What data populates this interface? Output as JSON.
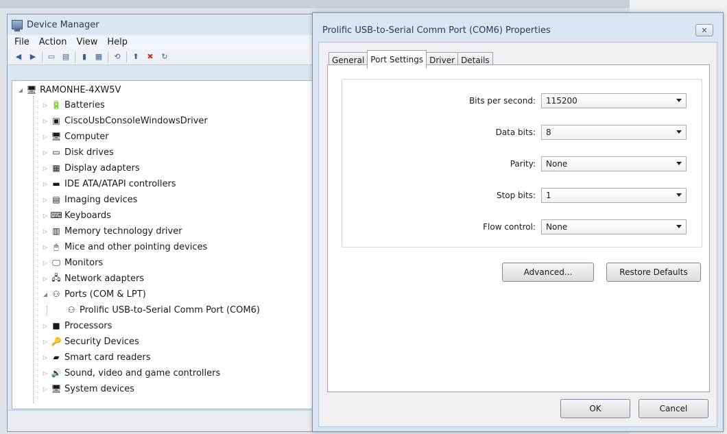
{
  "device_manager": {
    "title": "Device Manager",
    "menu": [
      "File",
      "Action",
      "View",
      "Help"
    ],
    "root": "RAMONHE-4XW5V",
    "tree": [
      {
        "label": "Batteries",
        "icon": "battery-icon",
        "glyph": "🔋",
        "expanded": false
      },
      {
        "label": "CiscoUsbConsoleWindowsDriver",
        "icon": "usb-driver-icon",
        "glyph": "▣",
        "expanded": false
      },
      {
        "label": "Computer",
        "icon": "computer-icon",
        "glyph": "🖥",
        "expanded": false
      },
      {
        "label": "Disk drives",
        "icon": "disk-drive-icon",
        "glyph": "▭",
        "expanded": false
      },
      {
        "label": "Display adapters",
        "icon": "display-adapter-icon",
        "glyph": "▦",
        "expanded": false
      },
      {
        "label": "IDE ATA/ATAPI controllers",
        "icon": "ide-controller-icon",
        "glyph": "▬",
        "expanded": false
      },
      {
        "label": "Imaging devices",
        "icon": "imaging-device-icon",
        "glyph": "▤",
        "expanded": false
      },
      {
        "label": "Keyboards",
        "icon": "keyboard-icon",
        "glyph": "⌨",
        "expanded": false
      },
      {
        "label": "Memory technology driver",
        "icon": "memory-icon",
        "glyph": "▥",
        "expanded": false
      },
      {
        "label": "Mice and other pointing devices",
        "icon": "mouse-icon",
        "glyph": "🖱",
        "expanded": false
      },
      {
        "label": "Monitors",
        "icon": "monitor-icon",
        "glyph": "🖵",
        "expanded": false
      },
      {
        "label": "Network adapters",
        "icon": "network-adapter-icon",
        "glyph": "🖧",
        "expanded": false
      },
      {
        "label": "Ports (COM & LPT)",
        "icon": "port-icon",
        "glyph": "⚇",
        "expanded": true
      },
      {
        "label": "Prolific USB-to-Serial Comm Port (COM6)",
        "icon": "port-icon",
        "glyph": "⚇",
        "child": true
      },
      {
        "label": "Processors",
        "icon": "processor-icon",
        "glyph": "■",
        "expanded": false
      },
      {
        "label": "Security Devices",
        "icon": "security-device-icon",
        "glyph": "🔑",
        "expanded": false
      },
      {
        "label": "Smart card readers",
        "icon": "smart-card-reader-icon",
        "glyph": "▰",
        "expanded": false
      },
      {
        "label": "Sound, video and game controllers",
        "icon": "sound-icon",
        "glyph": "🔊",
        "expanded": false
      },
      {
        "label": "System devices",
        "icon": "system-device-icon",
        "glyph": "🖥",
        "expanded": false
      }
    ]
  },
  "dialog": {
    "title": "Prolific USB-to-Serial Comm Port (COM6) Properties",
    "tabs": [
      "General",
      "Port Settings",
      "Driver",
      "Details"
    ],
    "active_tab": "Port Settings",
    "fields": [
      {
        "label": "Bits per second:",
        "value": "115200"
      },
      {
        "label": "Data bits:",
        "value": "8"
      },
      {
        "label": "Parity:",
        "value": "None"
      },
      {
        "label": "Stop bits:",
        "value": "1"
      },
      {
        "label": "Flow control:",
        "value": "None"
      }
    ],
    "advanced_label": "Advanced...",
    "restore_label": "Restore Defaults",
    "ok_label": "OK",
    "cancel_label": "Cancel",
    "close_glyph": "✕"
  }
}
